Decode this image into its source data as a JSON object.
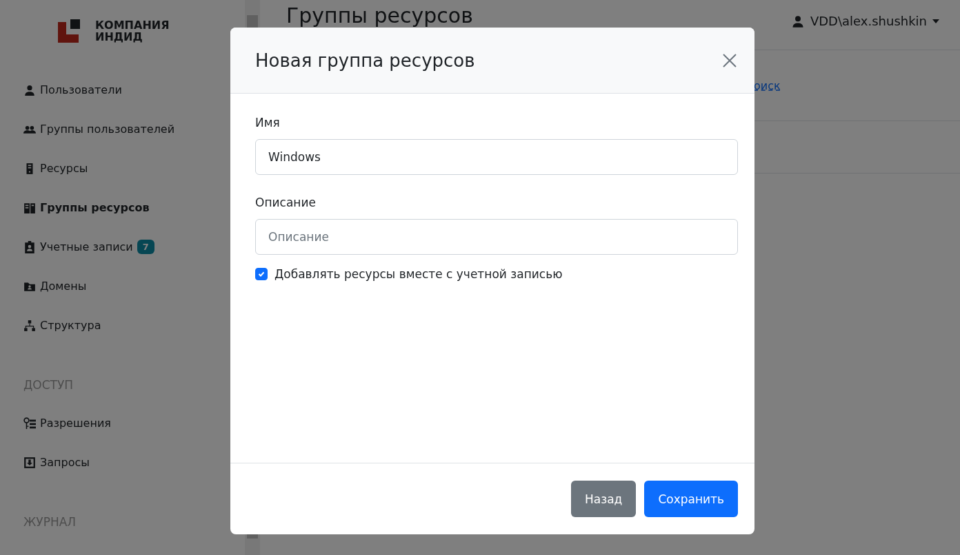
{
  "logo": {
    "line_1": "КОМПАНИЯ",
    "line_2": "ИНДИД"
  },
  "sidebar": {
    "items": [
      {
        "label": "Пользователи",
        "kind": "user",
        "selected": false
      },
      {
        "label": "Группы пользователей",
        "kind": "users",
        "selected": false
      },
      {
        "label": "Ресурсы",
        "kind": "server",
        "selected": false
      },
      {
        "label": "Группы ресурсов",
        "kind": "servers",
        "selected": true
      },
      {
        "label": "Учетные записи",
        "kind": "badge",
        "selected": false,
        "count": "7"
      },
      {
        "label": "Домены",
        "kind": "folder",
        "selected": false
      },
      {
        "label": "Структура",
        "kind": "tree",
        "selected": false
      }
    ],
    "sections": [
      {
        "title": "ДОСТУП",
        "items": [
          {
            "label": "Разрешения",
            "kind": "keylist",
            "selected": false
          },
          {
            "label": "Запросы",
            "kind": "inbox",
            "selected": false
          }
        ]
      },
      {
        "title": "ЖУРНАЛ"
      }
    ]
  },
  "page": {
    "title": "Группы ресурсов",
    "user": "VDD\\alex.shushkin",
    "link": "оиск"
  },
  "modal": {
    "title": "Новая группа ресурсов",
    "fields": [
      {
        "label": "Имя",
        "value": "Windows"
      },
      {
        "label": "Описание",
        "placeholder": "Описание"
      }
    ],
    "checkbox": {
      "label": "Добавлять ресурсы вместе с учетной записью",
      "checked": true
    },
    "buttons": [
      {
        "label": "Назад",
        "kind": "secondary"
      },
      {
        "label": "Сохранить",
        "kind": "primary"
      }
    ]
  }
}
